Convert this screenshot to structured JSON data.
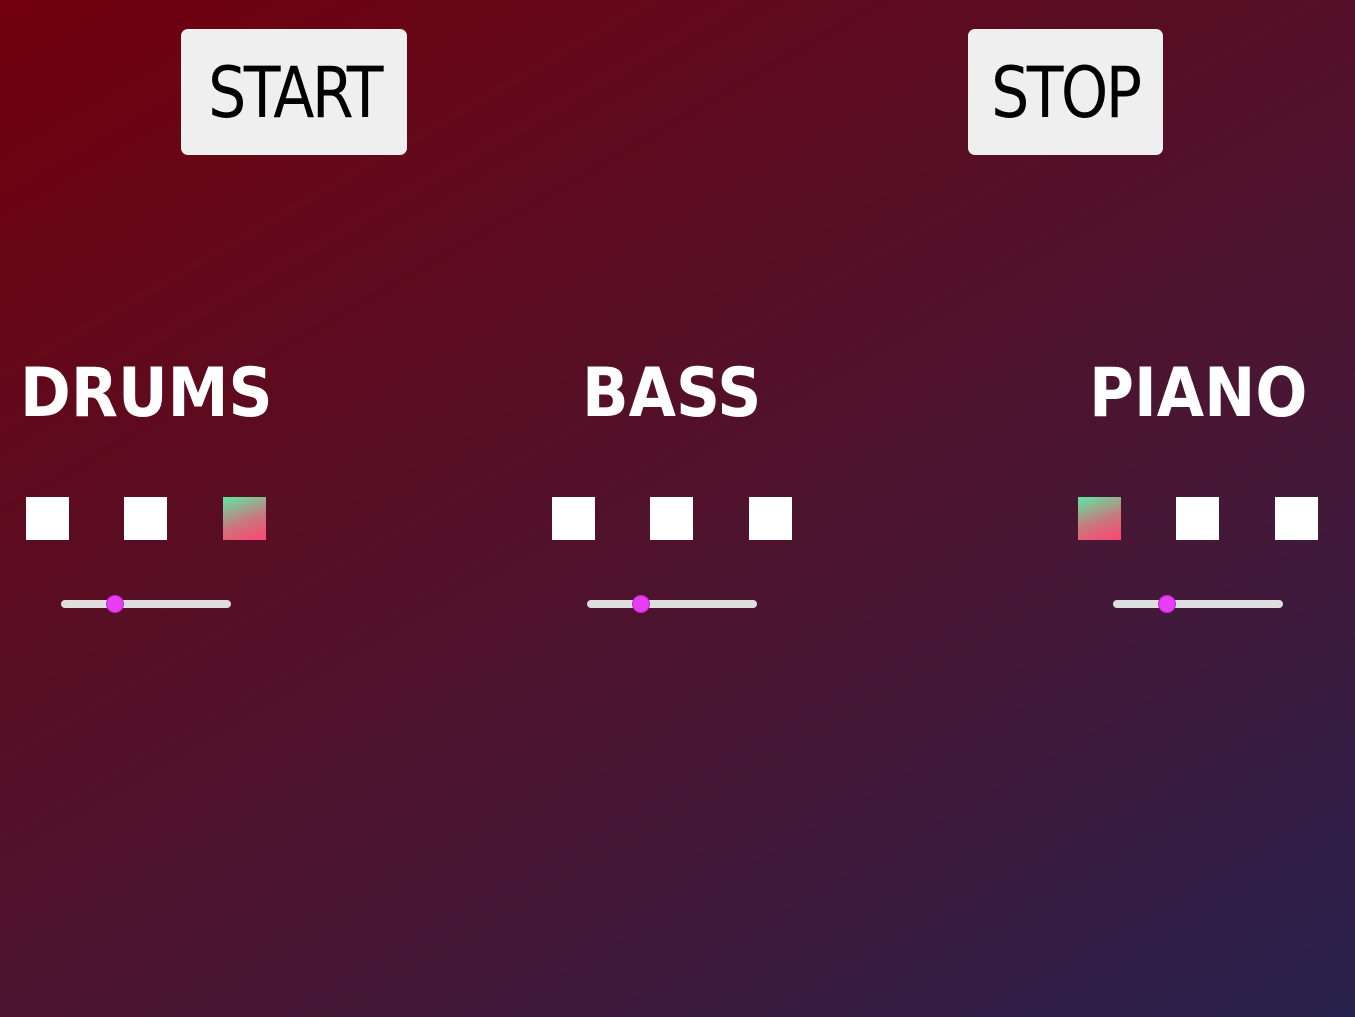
{
  "controls": {
    "start_label": "START",
    "stop_label": "STOP"
  },
  "instruments": [
    {
      "name": "DRUMS",
      "pads": [
        false,
        false,
        true
      ],
      "volume": 0.32
    },
    {
      "name": "BASS",
      "pads": [
        false,
        false,
        false
      ],
      "volume": 0.32
    },
    {
      "name": "PIANO",
      "pads": [
        true,
        false,
        false
      ],
      "volume": 0.32
    }
  ],
  "colors": {
    "background_start": "#72000d",
    "background_end": "#28224e",
    "button_bg": "#efefef",
    "pad_off": "#ffffff",
    "pad_on_from": "#5ee8a4",
    "pad_on_to": "#ff4470",
    "slider_track": "#dedede",
    "slider_thumb": "#e93cf5"
  }
}
